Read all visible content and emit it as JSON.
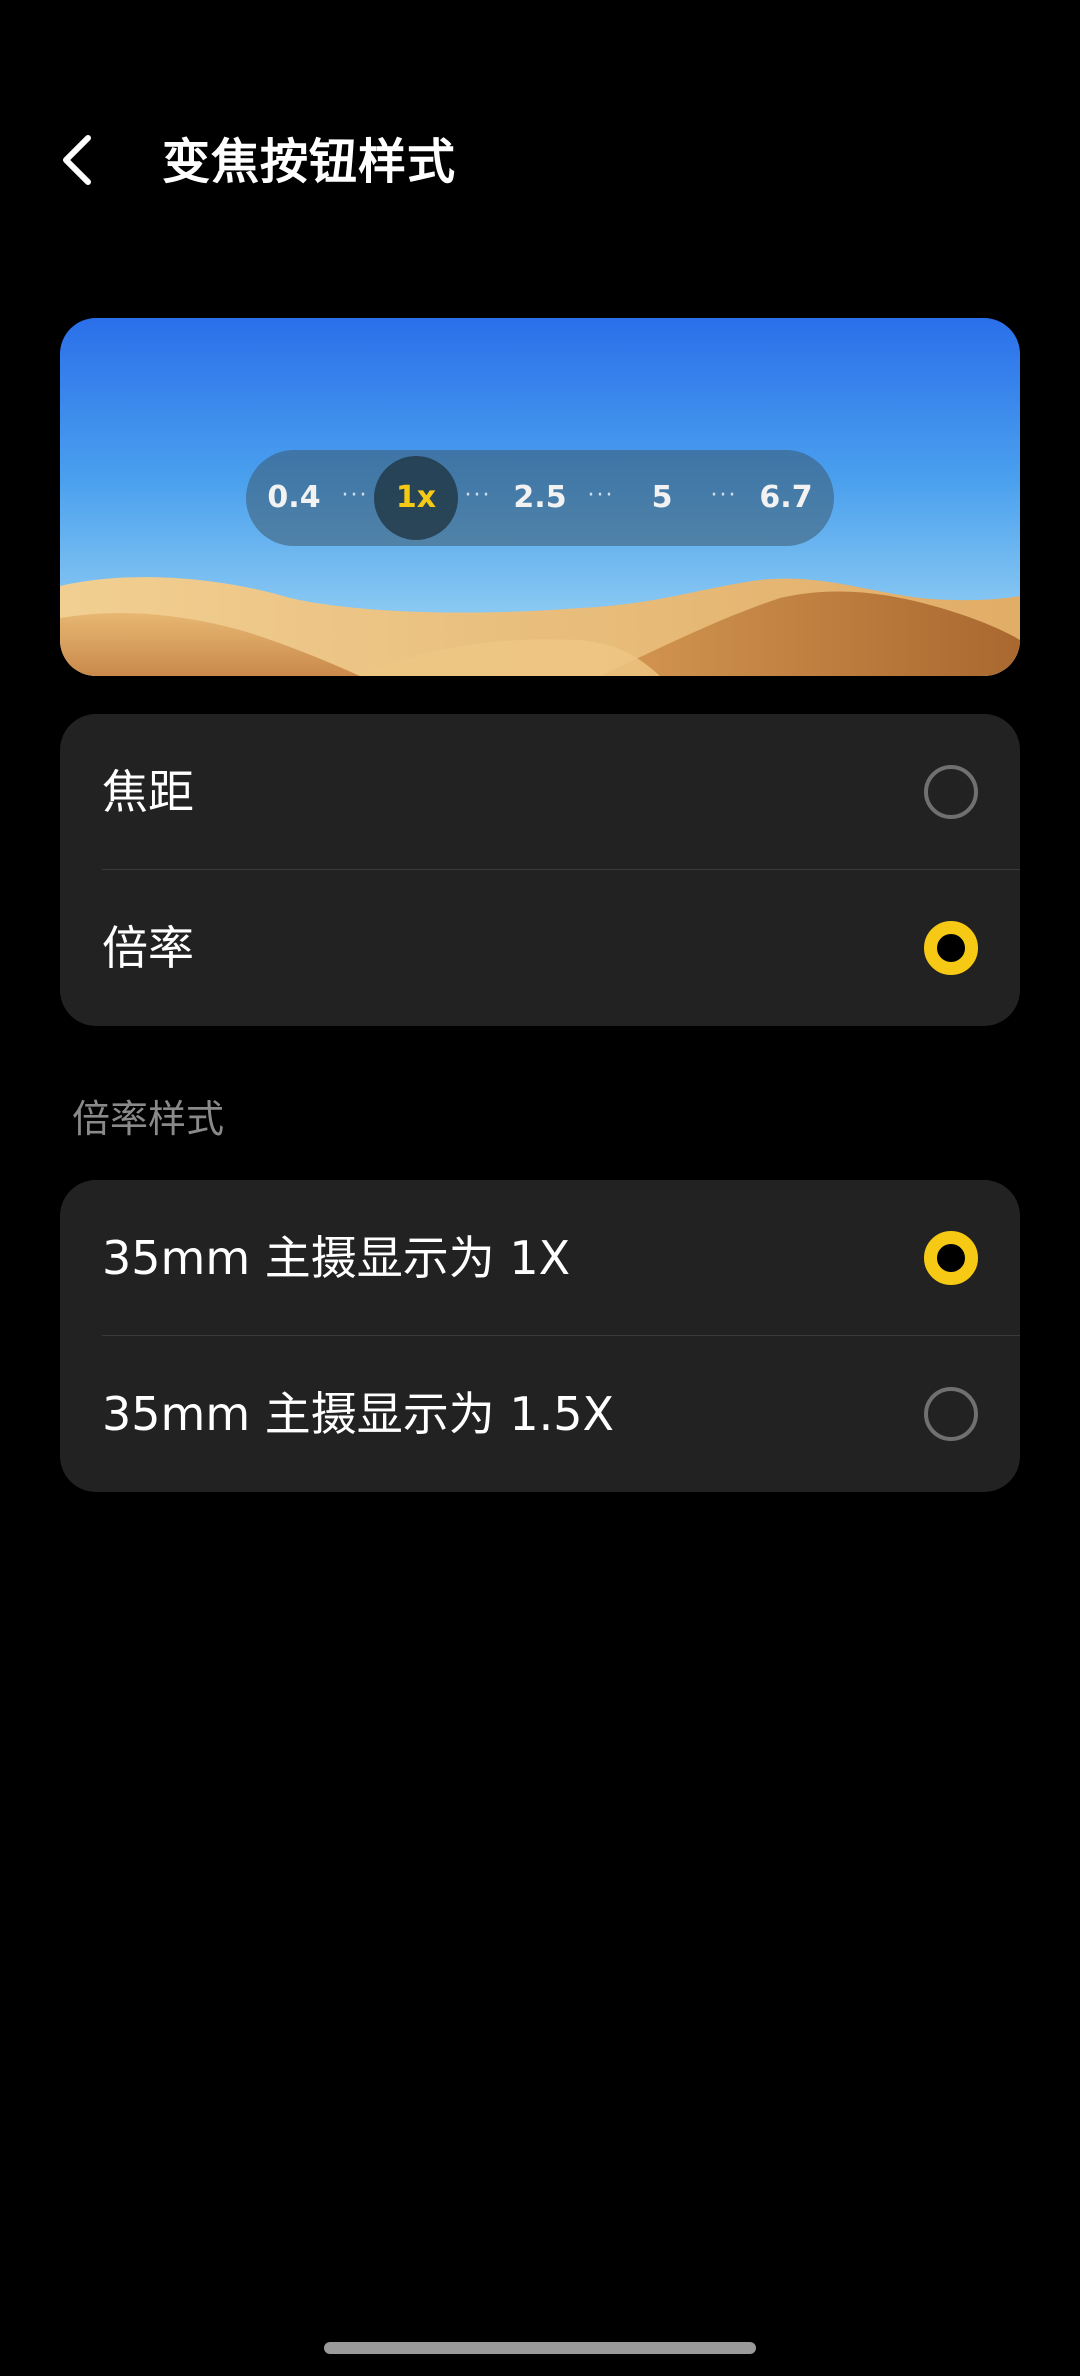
{
  "header": {
    "title": "变焦按钮样式",
    "back_icon": "chevron-left-icon"
  },
  "preview": {
    "zoom_levels": [
      {
        "label": "0.4",
        "active": false
      },
      {
        "label": "1x",
        "active": true
      },
      {
        "label": "2.5",
        "active": false
      },
      {
        "label": "5",
        "active": false
      },
      {
        "label": "6.7",
        "active": false
      }
    ],
    "active_color": "#f6c915"
  },
  "style_options": [
    {
      "label": "焦距",
      "selected": false
    },
    {
      "label": "倍率",
      "selected": true
    }
  ],
  "ratio_section": {
    "title": "倍率样式",
    "options": [
      {
        "label": "35mm 主摄显示为 1X",
        "selected": true
      },
      {
        "label": "35mm 主摄显示为 1.5X",
        "selected": false
      }
    ]
  },
  "colors": {
    "background": "#000000",
    "card": "#222222",
    "accent": "#f6c915"
  }
}
